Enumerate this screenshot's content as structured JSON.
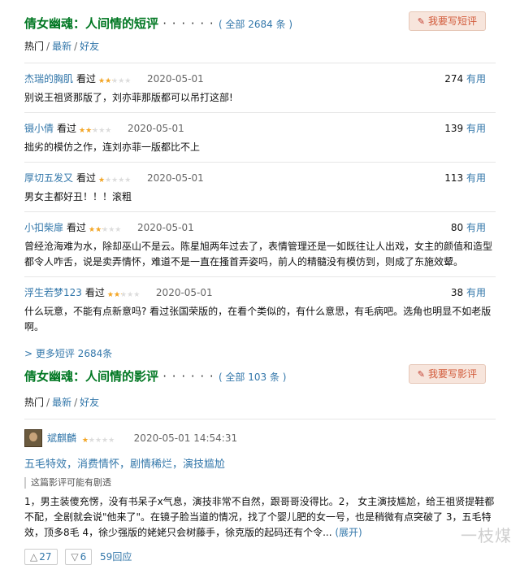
{
  "short_reviews": {
    "title": "倩女幽魂：人间情的短评",
    "dots": "· · · · · ·",
    "count": "( 全部 2684 条 )",
    "write_button": "我要写短评",
    "tabs": [
      "热门",
      "最新",
      "好友"
    ],
    "items": [
      {
        "user": "杰瑞的胸肌",
        "status": "看过",
        "stars": 2,
        "date": "2020-05-01",
        "useful": "274",
        "useful_label": "有用",
        "body": "别说王祖贤那版了，刘亦菲那版都可以吊打这部!"
      },
      {
        "user": "镊小倩",
        "status": "看过",
        "stars": 2,
        "date": "2020-05-01",
        "useful": "139",
        "useful_label": "有用",
        "body": "拙劣的模仿之作，连刘亦菲一版都比不上"
      },
      {
        "user": "厚切五发又",
        "status": "看过",
        "stars": 1,
        "date": "2020-05-01",
        "useful": "113",
        "useful_label": "有用",
        "body": "男女主都好丑！！！滚粗"
      },
      {
        "user": "小扣柴扉",
        "status": "看过",
        "stars": 2,
        "date": "2020-05-01",
        "useful": "80",
        "useful_label": "有用",
        "body": "曾经沧海难为水，除却巫山不是云。陈星旭两年过去了，表情管理还是一如既往让人出戏，女主的颜值和造型都令人咋舌，说是卖弄情怀，难道不是一直在搔首弄姿吗，前人的精髓没有模仿到，则成了东施效颦。"
      },
      {
        "user": "浮生若梦123",
        "status": "看过",
        "stars": 2,
        "date": "2020-05-01",
        "useful": "38",
        "useful_label": "有用",
        "body": "什么玩意，不能有点新意吗? 看过张国荣版的，在看个类似的，有什么意思，有毛病吧。选角也明显不如老版啊。"
      }
    ],
    "more_link": "> 更多短评 2684条"
  },
  "long_reviews": {
    "title": "倩女幽魂：人间情的影评",
    "dots": "· · · · · ·",
    "count": "( 全部 103 条 )",
    "write_button": "我要写影评",
    "tabs": [
      "热门",
      "最新",
      "好友"
    ],
    "review": {
      "user": "斌麒麟",
      "stars": 1,
      "datetime": "2020-05-01 14:54:31",
      "title": "五毛特效，消费情怀，剧情稀烂，演技尴尬",
      "spoiler": "这篇影评可能有剧透",
      "body": "1，男主装傻充愣，没有书呆子x气息，演技非常不自然，跟哥哥没得比。2， 女主演技尴尬，给王祖贤提鞋都不配，全剧就会说\"他来了\"。在镜子脸当道的情况，找了个婴儿肥的女一号，也是稍微有点突破了 3，五毛特效，顶多8毛 4，徐少强版的姥姥只会树藤手，徐克版的起码还有个令...",
      "expand": "(展开)",
      "up": "27",
      "down": "6",
      "replies": "59回应"
    }
  },
  "watermark": "一枝煤",
  "colors": {
    "green_title": "#007722",
    "link": "#3377aa",
    "star": "#f5a623",
    "button_bg": "#f7e5dc",
    "button_text": "#d25a3a"
  }
}
